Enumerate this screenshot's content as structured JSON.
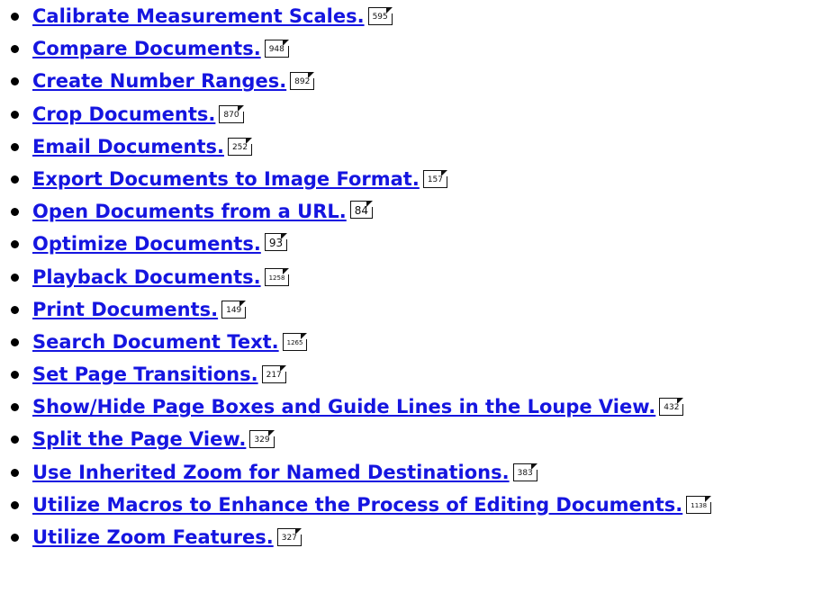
{
  "items": [
    {
      "label": "Calibrate Measurement Scales.",
      "pages": "595"
    },
    {
      "label": "Compare Documents.",
      "pages": "948"
    },
    {
      "label": "Create Number Ranges.",
      "pages": "892"
    },
    {
      "label": "Crop Documents.",
      "pages": "870"
    },
    {
      "label": "Email Documents.",
      "pages": "252"
    },
    {
      "label": "Export Documents to Image Format.",
      "pages": "157"
    },
    {
      "label": "Open Documents from a URL.",
      "pages": "84"
    },
    {
      "label": "Optimize Documents.",
      "pages": "93"
    },
    {
      "label": "Playback Documents.",
      "pages": "1258"
    },
    {
      "label": "Print Documents.",
      "pages": "149"
    },
    {
      "label": "Search Document Text.",
      "pages": "1265"
    },
    {
      "label": "Set Page Transitions.",
      "pages": "217"
    },
    {
      "label": "Show/Hide Page Boxes and Guide Lines in the Loupe View.",
      "pages": "432"
    },
    {
      "label": "Split the Page View.",
      "pages": "329"
    },
    {
      "label": "Use Inherited Zoom for Named Destinations.",
      "pages": "383"
    },
    {
      "label": "Utilize Macros to Enhance the Process of Editing Documents.",
      "pages": "1138"
    },
    {
      "label": "Utilize Zoom Features.",
      "pages": "327"
    }
  ],
  "colors": {
    "link": "#1515e0",
    "bullet": "#000000"
  },
  "icons": {
    "page_reference": "page-reference-icon",
    "bullet": "bullet-icon"
  }
}
